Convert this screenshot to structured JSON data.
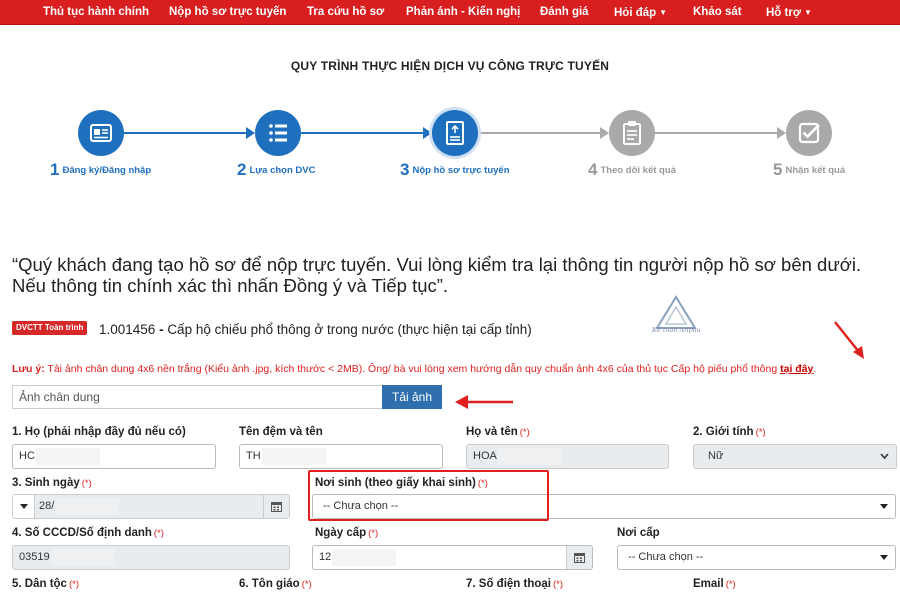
{
  "nav": {
    "items": [
      {
        "label": "Thủ tục hành chính",
        "caret": false
      },
      {
        "label": "Nộp hồ sơ trực tuyến",
        "caret": false
      },
      {
        "label": "Tra cứu hồ sơ",
        "caret": false
      },
      {
        "label": "Phản ánh - Kiến nghị",
        "caret": false
      },
      {
        "label": "Đánh giá",
        "caret": false
      },
      {
        "label": "Hỏi đáp",
        "caret": true
      },
      {
        "label": "Khảo sát",
        "caret": false
      },
      {
        "label": "Hỗ trợ",
        "caret": true
      }
    ],
    "caret_glyph": "▼"
  },
  "process_title": "QUY TRÌNH THỰC HIỆN DỊCH VỤ CÔNG TRỰC TUYẾN",
  "steps": [
    {
      "num": "1",
      "label": "Đăng ký/Đăng nhập",
      "status": "done",
      "icon": "id-card-icon"
    },
    {
      "num": "2",
      "label": "Lựa chọn DVC",
      "status": "done",
      "icon": "list-icon"
    },
    {
      "num": "3",
      "label": "Nộp hồ sơ trực tuyến",
      "status": "current",
      "icon": "document-icon"
    },
    {
      "num": "4",
      "label": "Theo dõi kết quả",
      "status": "pending",
      "icon": "clipboard-icon"
    },
    {
      "num": "5",
      "label": "Nhận kết quả",
      "status": "pending",
      "icon": "check-icon"
    }
  ],
  "colors": {
    "primary": "#1f6fbf",
    "primary_dark": "#15528f",
    "pending": "#a9a9a9",
    "nav_bg": "#d81e1e",
    "required": "#e02020"
  },
  "notice": "“Quý khách đang tạo hồ sơ để nộp trực tuyến. Vui lòng kiểm tra lại thông tin người nộp hồ sơ bên dưới. Nếu thông tin chính xác thì nhấn Đồng ý và Tiếp tục”.",
  "service": {
    "badge": "DVCTT Toàn trình",
    "code": "1.001456",
    "separator": " - ",
    "name": "Cấp hộ chiếu phổ thông ở trong nước (thực hiện tại cấp tỉnh)"
  },
  "watermark_text": "Kế toán Anpha",
  "warning": {
    "prefix": "Lưu ý:",
    "text": " Tải ảnh chân dung 4x6 nền trắng (Kiểu ảnh .jpg, kích thước < 2MB). Ông/ bà vui lòng xem hướng dẫn quy chuẩn ảnh 4x6 của thủ tục Cấp hộ piếu phổ thông ",
    "link": "tại đây",
    "suffix": "."
  },
  "upload": {
    "placeholder": "Ảnh chân dung",
    "button": "Tải ảnh"
  },
  "required_mark": "(*)",
  "form": {
    "ho": {
      "label": "1. Họ (phải nhập đầy đủ nếu có)",
      "value": "HC",
      "required": false
    },
    "ten_dem": {
      "label": "Tên đệm và tên",
      "value": "TH",
      "required": false
    },
    "ho_va_ten": {
      "label": "Họ và tên",
      "value": "HOA",
      "required": true
    },
    "gioi_tinh": {
      "label": "2. Giới tính",
      "value": "Nữ",
      "required": true
    },
    "sinh_ngay": {
      "label": "3. Sinh ngày",
      "value": "28/",
      "required": true
    },
    "noi_sinh": {
      "label": "Nơi sinh (theo giấy khai sinh)",
      "value": "-- Chưa chọn --",
      "required": true
    },
    "so_cccd": {
      "label": "4. Số CCCD/Số định danh",
      "value": "03519",
      "required": true
    },
    "ngay_cap": {
      "label": "Ngày cấp",
      "value": "12",
      "required": true
    },
    "noi_cap": {
      "label": "Nơi cấp",
      "value": "-- Chưa chọn --",
      "required": false
    },
    "dan_toc": {
      "label": "5. Dân tộc",
      "required": true
    },
    "ton_giao": {
      "label": "6. Tôn giáo",
      "required": true
    },
    "so_dien_thoai": {
      "label": "7. Số điện thoại",
      "required": true
    },
    "email": {
      "label": "Email",
      "required": true
    }
  }
}
